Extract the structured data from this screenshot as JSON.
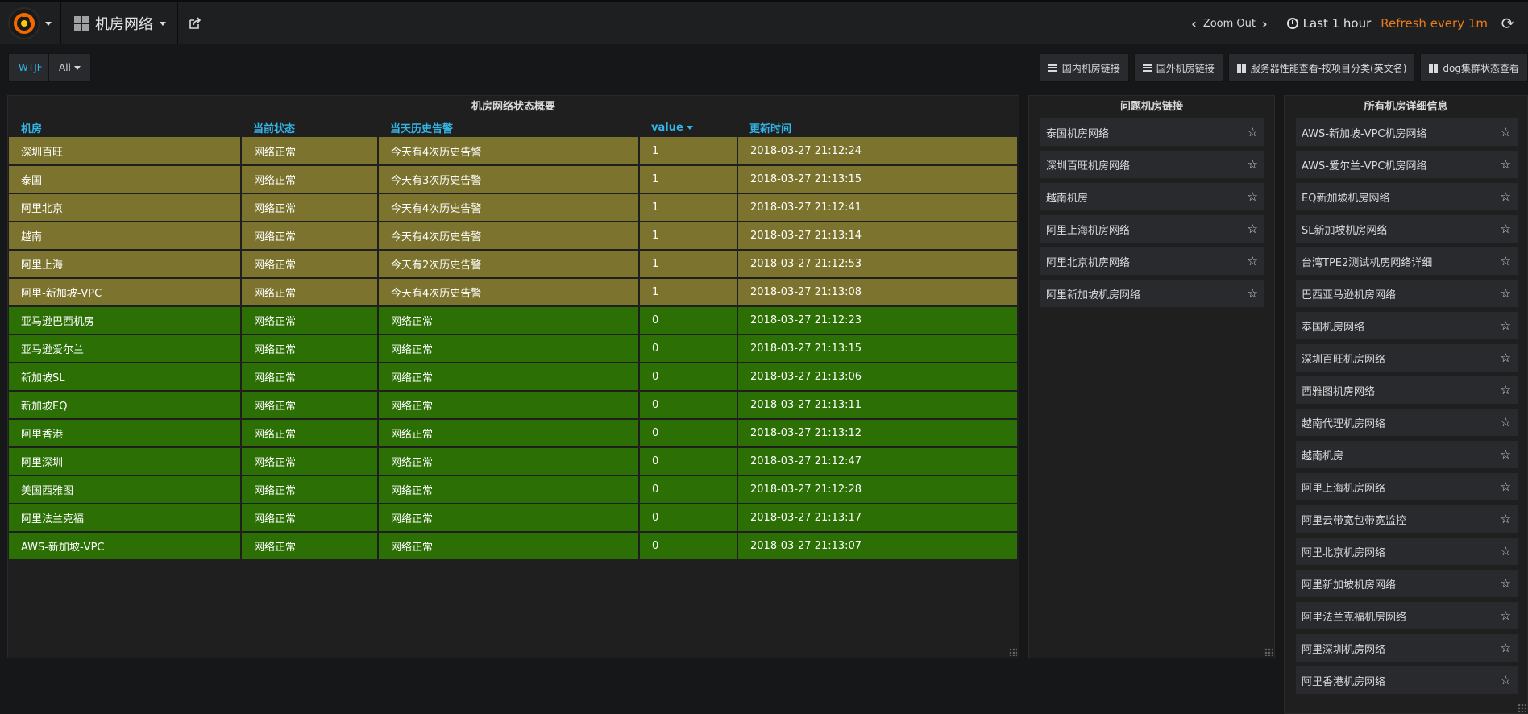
{
  "navbar": {
    "dashboard_title": "机房网络",
    "zoom_out": "Zoom Out",
    "time_range": "Last 1 hour",
    "refresh": "Refresh every 1m"
  },
  "variables": {
    "label": "WTJF",
    "value": "All"
  },
  "links": [
    {
      "label": "国内机房链接",
      "icon": "bars-icon"
    },
    {
      "label": "国外机房链接",
      "icon": "bars-icon"
    },
    {
      "label": "服务器性能查看-按项目分类(英文名)",
      "icon": "dashboard-icon"
    },
    {
      "label": "dog集群状态查看",
      "icon": "dashboard-icon"
    }
  ],
  "status_panel": {
    "title": "机房网络状态概要",
    "columns": [
      "机房",
      "当前状态",
      "当天历史告警",
      "value",
      "更新时间"
    ],
    "colors": {
      "warn": "#7c742e",
      "ok": "#2b6f05"
    },
    "rows": [
      {
        "room": "深圳百旺",
        "state": "网络正常",
        "alarm": "今天有4次历史告警",
        "value": "1",
        "time": "2018-03-27 21:12:24",
        "level": "warn"
      },
      {
        "room": "泰国",
        "state": "网络正常",
        "alarm": "今天有3次历史告警",
        "value": "1",
        "time": "2018-03-27 21:13:15",
        "level": "warn"
      },
      {
        "room": "阿里北京",
        "state": "网络正常",
        "alarm": "今天有4次历史告警",
        "value": "1",
        "time": "2018-03-27 21:12:41",
        "level": "warn"
      },
      {
        "room": "越南",
        "state": "网络正常",
        "alarm": "今天有4次历史告警",
        "value": "1",
        "time": "2018-03-27 21:13:14",
        "level": "warn"
      },
      {
        "room": "阿里上海",
        "state": "网络正常",
        "alarm": "今天有2次历史告警",
        "value": "1",
        "time": "2018-03-27 21:12:53",
        "level": "warn"
      },
      {
        "room": "阿里-新加坡-VPC",
        "state": "网络正常",
        "alarm": "今天有4次历史告警",
        "value": "1",
        "time": "2018-03-27 21:13:08",
        "level": "warn"
      },
      {
        "room": "亚马逊巴西机房",
        "state": "网络正常",
        "alarm": "网络正常",
        "value": "0",
        "time": "2018-03-27 21:12:23",
        "level": "ok"
      },
      {
        "room": "亚马逊爱尔兰",
        "state": "网络正常",
        "alarm": "网络正常",
        "value": "0",
        "time": "2018-03-27 21:13:15",
        "level": "ok"
      },
      {
        "room": "新加坡SL",
        "state": "网络正常",
        "alarm": "网络正常",
        "value": "0",
        "time": "2018-03-27 21:13:06",
        "level": "ok"
      },
      {
        "room": "新加坡EQ",
        "state": "网络正常",
        "alarm": "网络正常",
        "value": "0",
        "time": "2018-03-27 21:13:11",
        "level": "ok"
      },
      {
        "room": "阿里香港",
        "state": "网络正常",
        "alarm": "网络正常",
        "value": "0",
        "time": "2018-03-27 21:13:12",
        "level": "ok"
      },
      {
        "room": "阿里深圳",
        "state": "网络正常",
        "alarm": "网络正常",
        "value": "0",
        "time": "2018-03-27 21:12:47",
        "level": "ok"
      },
      {
        "room": "美国西雅图",
        "state": "网络正常",
        "alarm": "网络正常",
        "value": "0",
        "time": "2018-03-27 21:12:28",
        "level": "ok"
      },
      {
        "room": "阿里法兰克福",
        "state": "网络正常",
        "alarm": "网络正常",
        "value": "0",
        "time": "2018-03-27 21:13:17",
        "level": "ok"
      },
      {
        "room": "AWS-新加坡-VPC",
        "state": "网络正常",
        "alarm": "网络正常",
        "value": "0",
        "time": "2018-03-27 21:13:07",
        "level": "ok"
      }
    ]
  },
  "problem_panel": {
    "title": "问题机房链接",
    "items": [
      "泰国机房网络",
      "深圳百旺机房网络",
      "越南机房",
      "阿里上海机房网络",
      "阿里北京机房网络",
      "阿里新加坡机房网络"
    ]
  },
  "all_panel": {
    "title": "所有机房详细信息",
    "items": [
      "AWS-新加坡-VPC机房网络",
      "AWS-爱尔兰-VPC机房网络",
      "EQ新加坡机房网络",
      "SL新加坡机房网络",
      "台湾TPE2测试机房网络详细",
      "巴西亚马逊机房网络",
      "泰国机房网络",
      "深圳百旺机房网络",
      "西雅图机房网络",
      "越南代理机房网络",
      "越南机房",
      "阿里上海机房网络",
      "阿里云带宽包带宽监控",
      "阿里北京机房网络",
      "阿里新加坡机房网络",
      "阿里法兰克福机房网络",
      "阿里深圳机房网络",
      "阿里香港机房网络"
    ]
  }
}
